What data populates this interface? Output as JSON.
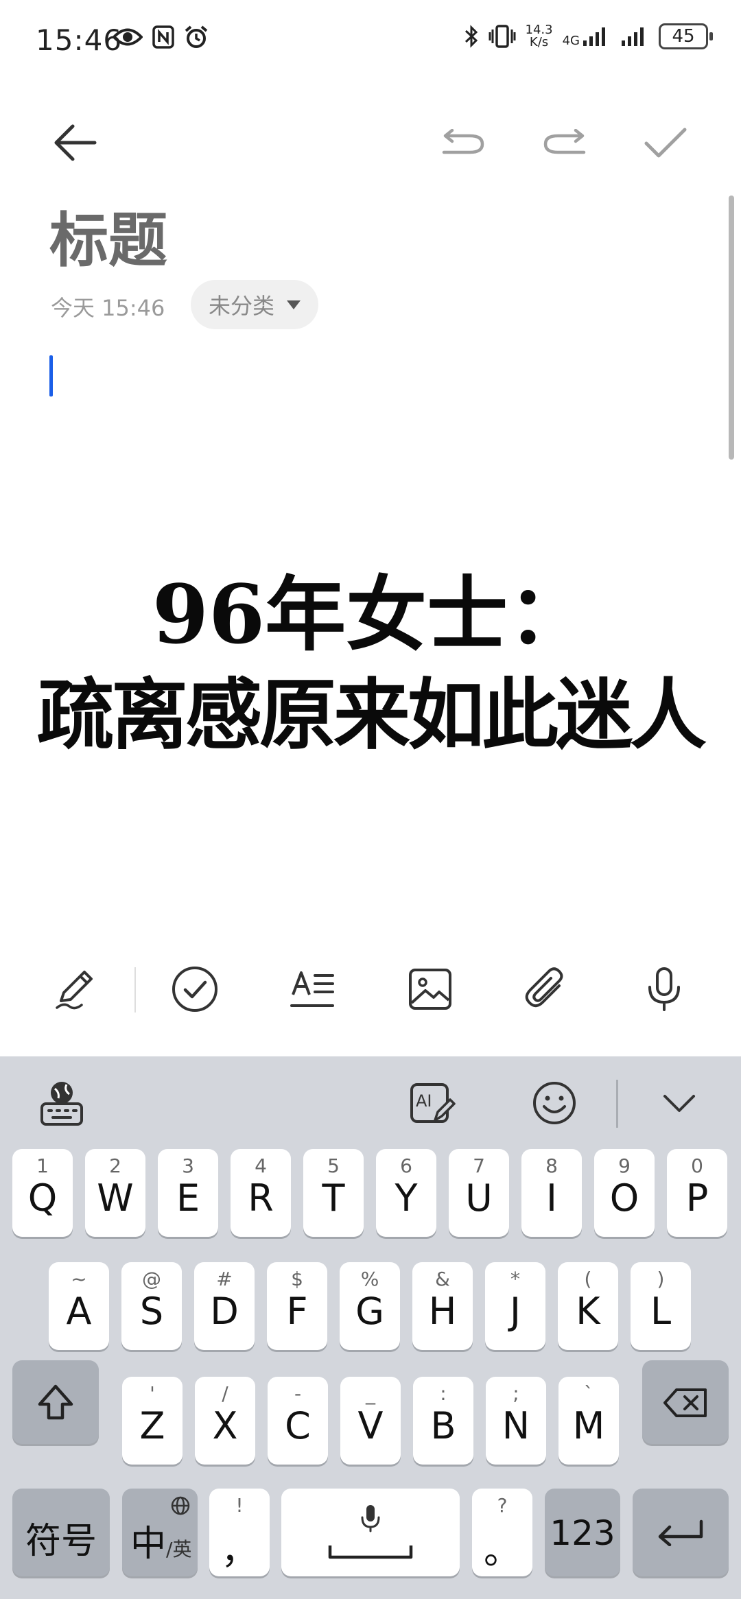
{
  "status_bar": {
    "time": "15:46",
    "net_speed_top": "14.3",
    "net_speed_bottom": "K/s",
    "network": "4G",
    "battery": "45"
  },
  "note": {
    "title": "标题",
    "date": "今天 15:46",
    "category": "未分类"
  },
  "overlay": {
    "line1": "96年女士：",
    "line2": "疏离感原来如此迷人"
  },
  "keyboard": {
    "row1": [
      {
        "sub": "1",
        "main": "Q"
      },
      {
        "sub": "2",
        "main": "W"
      },
      {
        "sub": "3",
        "main": "E"
      },
      {
        "sub": "4",
        "main": "R"
      },
      {
        "sub": "5",
        "main": "T"
      },
      {
        "sub": "6",
        "main": "Y"
      },
      {
        "sub": "7",
        "main": "U"
      },
      {
        "sub": "8",
        "main": "I"
      },
      {
        "sub": "9",
        "main": "O"
      },
      {
        "sub": "0",
        "main": "P"
      }
    ],
    "row2": [
      {
        "sub": "~",
        "main": "A"
      },
      {
        "sub": "@",
        "main": "S"
      },
      {
        "sub": "#",
        "main": "D"
      },
      {
        "sub": "$",
        "main": "F"
      },
      {
        "sub": "%",
        "main": "G"
      },
      {
        "sub": "&",
        "main": "H"
      },
      {
        "sub": "*",
        "main": "J"
      },
      {
        "sub": "(",
        "main": "K"
      },
      {
        "sub": ")",
        "main": "L"
      }
    ],
    "row3": [
      {
        "sub": "'",
        "main": "Z"
      },
      {
        "sub": "/",
        "main": "X"
      },
      {
        "sub": "-",
        "main": "C"
      },
      {
        "sub": "_",
        "main": "V"
      },
      {
        "sub": ":",
        "main": "B"
      },
      {
        "sub": ";",
        "main": "N"
      },
      {
        "sub": "`",
        "main": "M"
      }
    ],
    "symbols_label": "符号",
    "lang_main": "中",
    "lang_sub": "/英",
    "comma_sub": "!",
    "comma_main": "，",
    "period_sub": "?",
    "period_main": "。",
    "numbers_label": "123"
  }
}
